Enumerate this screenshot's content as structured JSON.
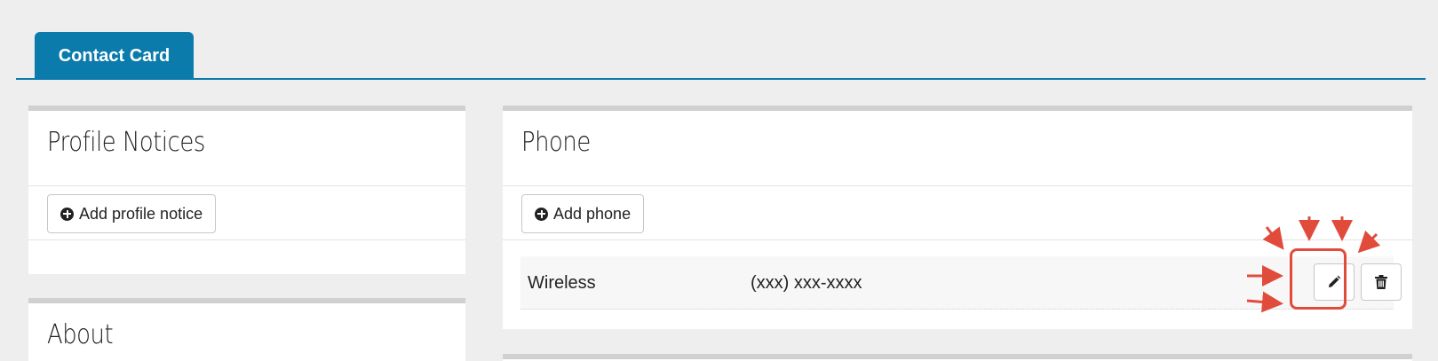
{
  "tabs": [
    {
      "label": "Contact Card",
      "active": true
    }
  ],
  "profile_notices": {
    "title": "Profile Notices",
    "add_button": "Add profile notice"
  },
  "about": {
    "title": "About"
  },
  "phone": {
    "title": "Phone",
    "add_button": "Add phone",
    "entries": [
      {
        "type": "Wireless",
        "number": "(xxx) xxx-xxxx"
      }
    ]
  },
  "colors": {
    "accent": "#0b7bab",
    "highlight": "#e14b3b",
    "panel_border": "#d0d0d0",
    "background": "#eeeeee"
  },
  "icons": {
    "add": "plus-circle-icon",
    "edit": "pencil-icon",
    "delete": "trash-icon"
  }
}
